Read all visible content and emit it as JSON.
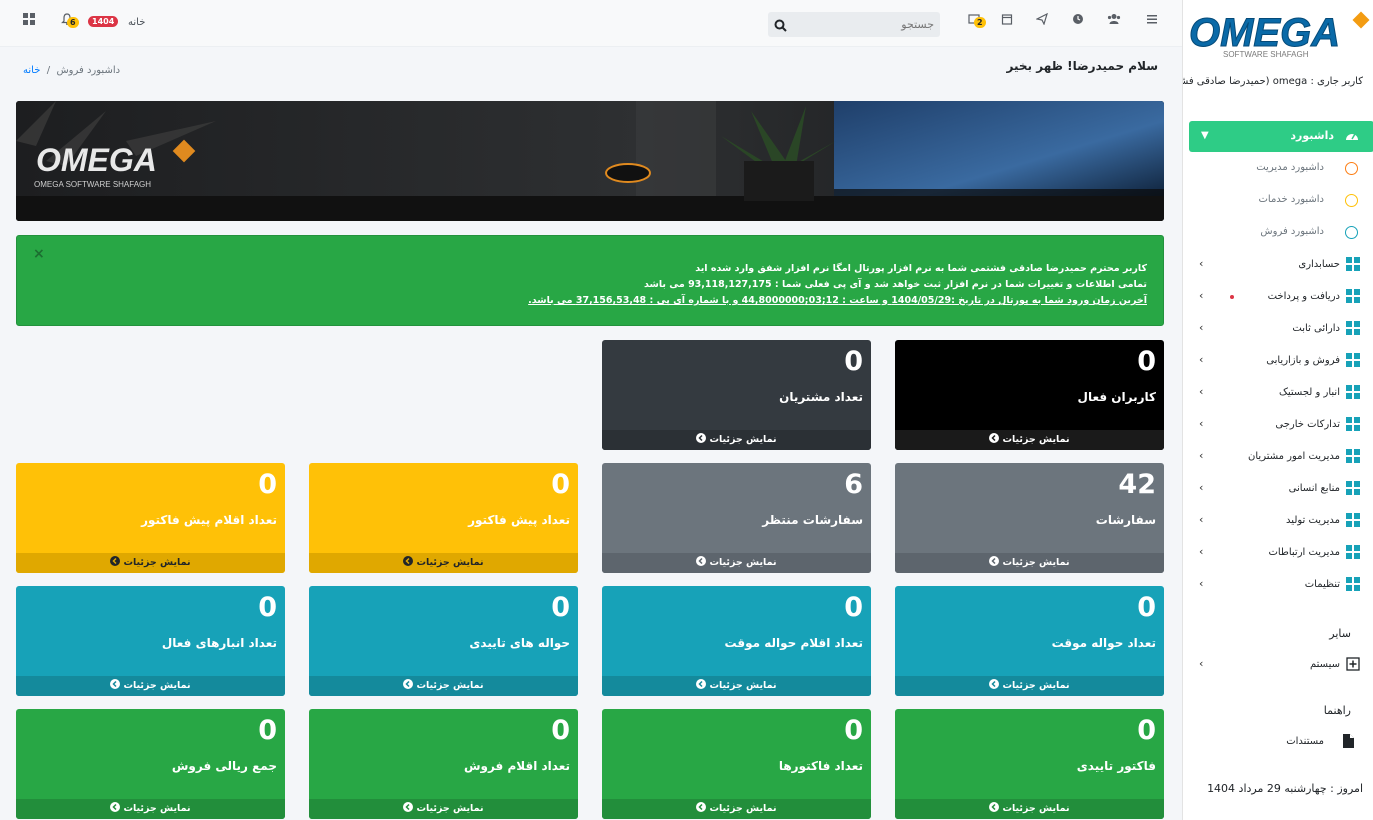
{
  "colors": {
    "sidebar_active": "#2ecc86",
    "box_black": "#000000",
    "box_dark": "#343a40",
    "box_gray": "#6c757d",
    "box_yellow": "#ffc107",
    "box_teal": "#17a2b8",
    "box_green": "#28a745",
    "alert_bg": "#28a745",
    "link": "#007bff"
  },
  "sidebar": {
    "logo_text": "OMEGA",
    "logo_sub": "SOFTWARE SHAFAGH",
    "current_user": "کاربر جاری : omega (حمیدرضا صادقی فشتمی)",
    "active_item": {
      "label": "داشبورد",
      "icon": "dashboard-gauge-icon"
    },
    "dashboard_subitems": [
      {
        "label": "داشبورد مدیریت",
        "color": "#fd7e14"
      },
      {
        "label": "داشبورد خدمات",
        "color": "#ffc107"
      },
      {
        "label": "داشبورد فروش",
        "color": "#17a2b8"
      }
    ],
    "items": [
      {
        "label": "حسابداری"
      },
      {
        "label": "دریافت و پرداخت",
        "dot": true
      },
      {
        "label": "دارائی ثابت"
      },
      {
        "label": "فروش و بازاریابی"
      },
      {
        "label": "انبار و لجستیک"
      },
      {
        "label": "تدارکات خارجی"
      },
      {
        "label": "مدیریت امور مشتریان"
      },
      {
        "label": "منابع انسانی"
      },
      {
        "label": "مدیریت تولید"
      },
      {
        "label": "مدیریت ارتباطات"
      },
      {
        "label": "تنظیمات"
      }
    ],
    "other_title": "سایر",
    "system_item": "سیستم",
    "help_title": "راهنما",
    "docs_item": "مستندات",
    "today": "امروز : چهارشنبه 29 مرداد 1404"
  },
  "navbar": {
    "search_placeholder": "جستجو",
    "tasks_badge": "2",
    "notif_badge": "6",
    "year_badge": "1404",
    "home_label": "خانه"
  },
  "header": {
    "greeting": "سلام حمیدرضا! ظهر بخیر",
    "breadcrumb_home": "خانه",
    "breadcrumb_sep": "/",
    "breadcrumb_current": "داشبورد فروش"
  },
  "banner": {
    "logo_text": "OMEGA",
    "logo_sub": "OMEGA SOFTWARE SHAFAGH"
  },
  "alert": {
    "close": "×",
    "line1": "کاربر محترم حمیدرضا صادقی فشتمی شما به نرم افزار پورتال امگا نرم افزار شفق وارد شده اید",
    "line2": "تمامی اطلاعات و تغییرات شما در نرم افزار ثبت خواهد شد و آی پی فعلی شما : 93,118,127,175 می باشد",
    "line3": "آخرین زمان ورود شما به پورتال در تاریخ :1404/05/29 و ساعت : 12;03;44,8000000 و با شماره آی پی : 37,156,53,48 می باشد."
  },
  "detail_label": "نمایش جزئیات",
  "stat_boxes": [
    {
      "value": "0",
      "title": "کاربران فعال",
      "color": "#000000",
      "footer": "#1a1a1a"
    },
    {
      "value": "0",
      "title": "تعداد مشتریان",
      "color": "#343a40",
      "footer": "#2b3035"
    },
    {
      "value": "42",
      "title": "سفارشات",
      "color": "#6c757d",
      "footer": "#5d656d"
    },
    {
      "value": "6",
      "title": "سفارشات منتظر",
      "color": "#6c757d",
      "footer": "#5d656d"
    },
    {
      "value": "0",
      "title": "تعداد پیش فاکتور",
      "color": "#ffc107",
      "footer": "#e0a800"
    },
    {
      "value": "0",
      "title": "تعداد اقلام پیش فاکتور",
      "color": "#ffc107",
      "footer": "#e0a800"
    },
    {
      "value": "0",
      "title": "تعداد حواله موقت",
      "color": "#17a2b8",
      "footer": "#148a9c"
    },
    {
      "value": "0",
      "title": "تعداد اقلام حواله موقت",
      "color": "#17a2b8",
      "footer": "#148a9c"
    },
    {
      "value": "0",
      "title": "حواله های تاییدی",
      "color": "#17a2b8",
      "footer": "#148a9c"
    },
    {
      "value": "0",
      "title": "تعداد انبارهای فعال",
      "color": "#17a2b8",
      "footer": "#148a9c"
    },
    {
      "value": "0",
      "title": "فاکتور تاییدی",
      "color": "#28a745",
      "footer": "#228e3b"
    },
    {
      "value": "0",
      "title": "تعداد فاکتورها",
      "color": "#28a745",
      "footer": "#228e3b"
    },
    {
      "value": "0",
      "title": "تعداد اقلام فروش",
      "color": "#28a745",
      "footer": "#228e3b"
    },
    {
      "value": "0",
      "title": "جمع ریالی فروش",
      "color": "#28a745",
      "footer": "#228e3b"
    }
  ]
}
